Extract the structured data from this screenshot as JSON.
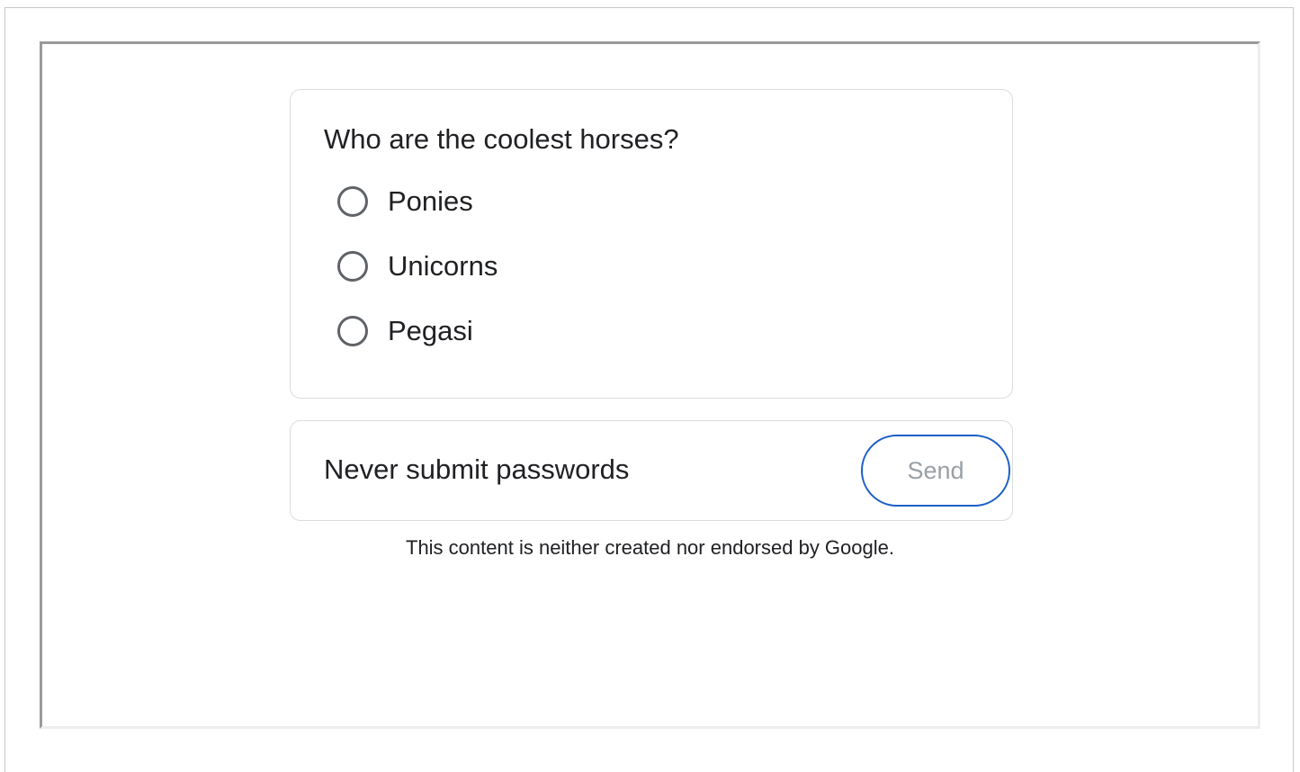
{
  "form": {
    "question": "Who are the coolest horses?",
    "options": [
      {
        "label": "Ponies"
      },
      {
        "label": "Unicorns"
      },
      {
        "label": "Pegasi"
      }
    ],
    "warning": "Never submit passwords",
    "send_label": "Send",
    "disclaimer": "This content is neither created nor endorsed by Google."
  },
  "colors": {
    "text": "#202124",
    "radio_border": "#5f6368",
    "card_border": "#dadce0",
    "button_border": "#1a5fc4",
    "button_text_disabled": "#9aa0a6"
  },
  "icons": {
    "radio": "radio-unchecked-icon"
  }
}
